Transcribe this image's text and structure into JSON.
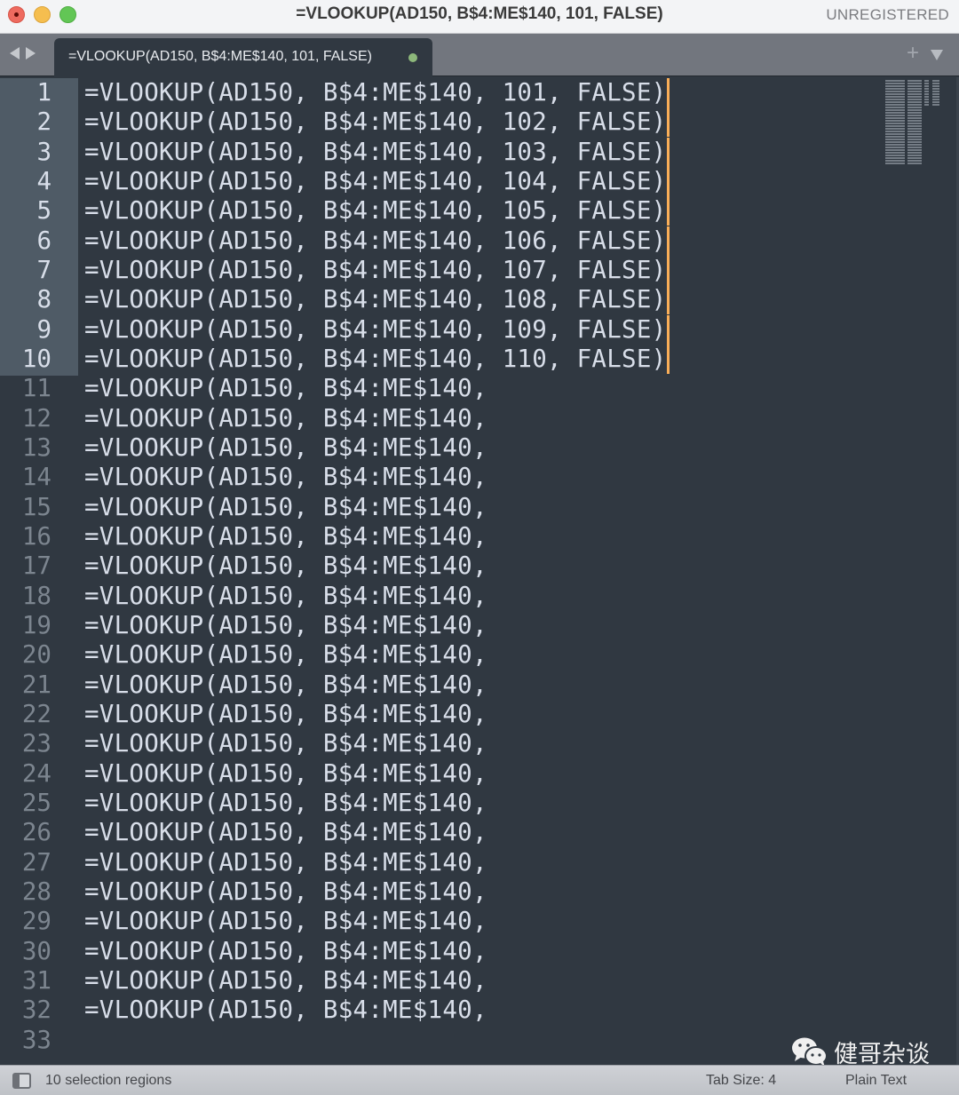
{
  "window": {
    "title": "=VLOOKUP(AD150, B$4:ME$140, 101, FALSE)",
    "license_status": "UNREGISTERED"
  },
  "tabs": [
    {
      "label": "=VLOOKUP(AD150, B$4:ME$140, 101, FALSE)",
      "modified": true,
      "active": true
    }
  ],
  "tabbar": {
    "new_tab_symbol": "+",
    "menu_symbol": "▼"
  },
  "editor": {
    "selected_lines": [
      1,
      2,
      3,
      4,
      5,
      6,
      7,
      8,
      9,
      10
    ],
    "lines": [
      {
        "n": "1",
        "text": "=VLOOKUP(AD150, B$4:ME$140, 101, FALSE)",
        "cursor": true
      },
      {
        "n": "2",
        "text": "=VLOOKUP(AD150, B$4:ME$140, 102, FALSE)",
        "cursor": true
      },
      {
        "n": "3",
        "text": "=VLOOKUP(AD150, B$4:ME$140, 103, FALSE)",
        "cursor": true
      },
      {
        "n": "4",
        "text": "=VLOOKUP(AD150, B$4:ME$140, 104, FALSE)",
        "cursor": true
      },
      {
        "n": "5",
        "text": "=VLOOKUP(AD150, B$4:ME$140, 105, FALSE)",
        "cursor": true
      },
      {
        "n": "6",
        "text": "=VLOOKUP(AD150, B$4:ME$140, 106, FALSE)",
        "cursor": true
      },
      {
        "n": "7",
        "text": "=VLOOKUP(AD150, B$4:ME$140, 107, FALSE)",
        "cursor": true
      },
      {
        "n": "8",
        "text": "=VLOOKUP(AD150, B$4:ME$140, 108, FALSE)",
        "cursor": true
      },
      {
        "n": "9",
        "text": "=VLOOKUP(AD150, B$4:ME$140, 109, FALSE)",
        "cursor": true
      },
      {
        "n": "10",
        "text": "=VLOOKUP(AD150, B$4:ME$140, 110, FALSE)",
        "cursor": true
      },
      {
        "n": "11",
        "text": "=VLOOKUP(AD150, B$4:ME$140,"
      },
      {
        "n": "12",
        "text": "=VLOOKUP(AD150, B$4:ME$140,"
      },
      {
        "n": "13",
        "text": "=VLOOKUP(AD150, B$4:ME$140,"
      },
      {
        "n": "14",
        "text": "=VLOOKUP(AD150, B$4:ME$140,"
      },
      {
        "n": "15",
        "text": "=VLOOKUP(AD150, B$4:ME$140,"
      },
      {
        "n": "16",
        "text": "=VLOOKUP(AD150, B$4:ME$140,"
      },
      {
        "n": "17",
        "text": "=VLOOKUP(AD150, B$4:ME$140,"
      },
      {
        "n": "18",
        "text": "=VLOOKUP(AD150, B$4:ME$140,"
      },
      {
        "n": "19",
        "text": "=VLOOKUP(AD150, B$4:ME$140,"
      },
      {
        "n": "20",
        "text": "=VLOOKUP(AD150, B$4:ME$140,"
      },
      {
        "n": "21",
        "text": "=VLOOKUP(AD150, B$4:ME$140,"
      },
      {
        "n": "22",
        "text": "=VLOOKUP(AD150, B$4:ME$140,"
      },
      {
        "n": "23",
        "text": "=VLOOKUP(AD150, B$4:ME$140,"
      },
      {
        "n": "24",
        "text": "=VLOOKUP(AD150, B$4:ME$140,"
      },
      {
        "n": "25",
        "text": "=VLOOKUP(AD150, B$4:ME$140,"
      },
      {
        "n": "26",
        "text": "=VLOOKUP(AD150, B$4:ME$140,"
      },
      {
        "n": "27",
        "text": "=VLOOKUP(AD150, B$4:ME$140,"
      },
      {
        "n": "28",
        "text": "=VLOOKUP(AD150, B$4:ME$140,"
      },
      {
        "n": "29",
        "text": "=VLOOKUP(AD150, B$4:ME$140,"
      },
      {
        "n": "30",
        "text": "=VLOOKUP(AD150, B$4:ME$140,"
      },
      {
        "n": "31",
        "text": "=VLOOKUP(AD150, B$4:ME$140,"
      },
      {
        "n": "32",
        "text": "=VLOOKUP(AD150, B$4:ME$140,"
      },
      {
        "n": "33",
        "text": ""
      }
    ]
  },
  "watermark": {
    "icon": "wechat-icon",
    "text": "健哥杂谈"
  },
  "statusbar": {
    "selection_info": "10 selection regions",
    "tab_size": "Tab Size: 4",
    "syntax": "Plain Text"
  },
  "colors": {
    "editor_bg": "#303841",
    "text": "#d8dee9",
    "cursor": "#f9ae58",
    "gutter_highlight": "#4f5b66",
    "modified_dot": "#8db87b"
  }
}
